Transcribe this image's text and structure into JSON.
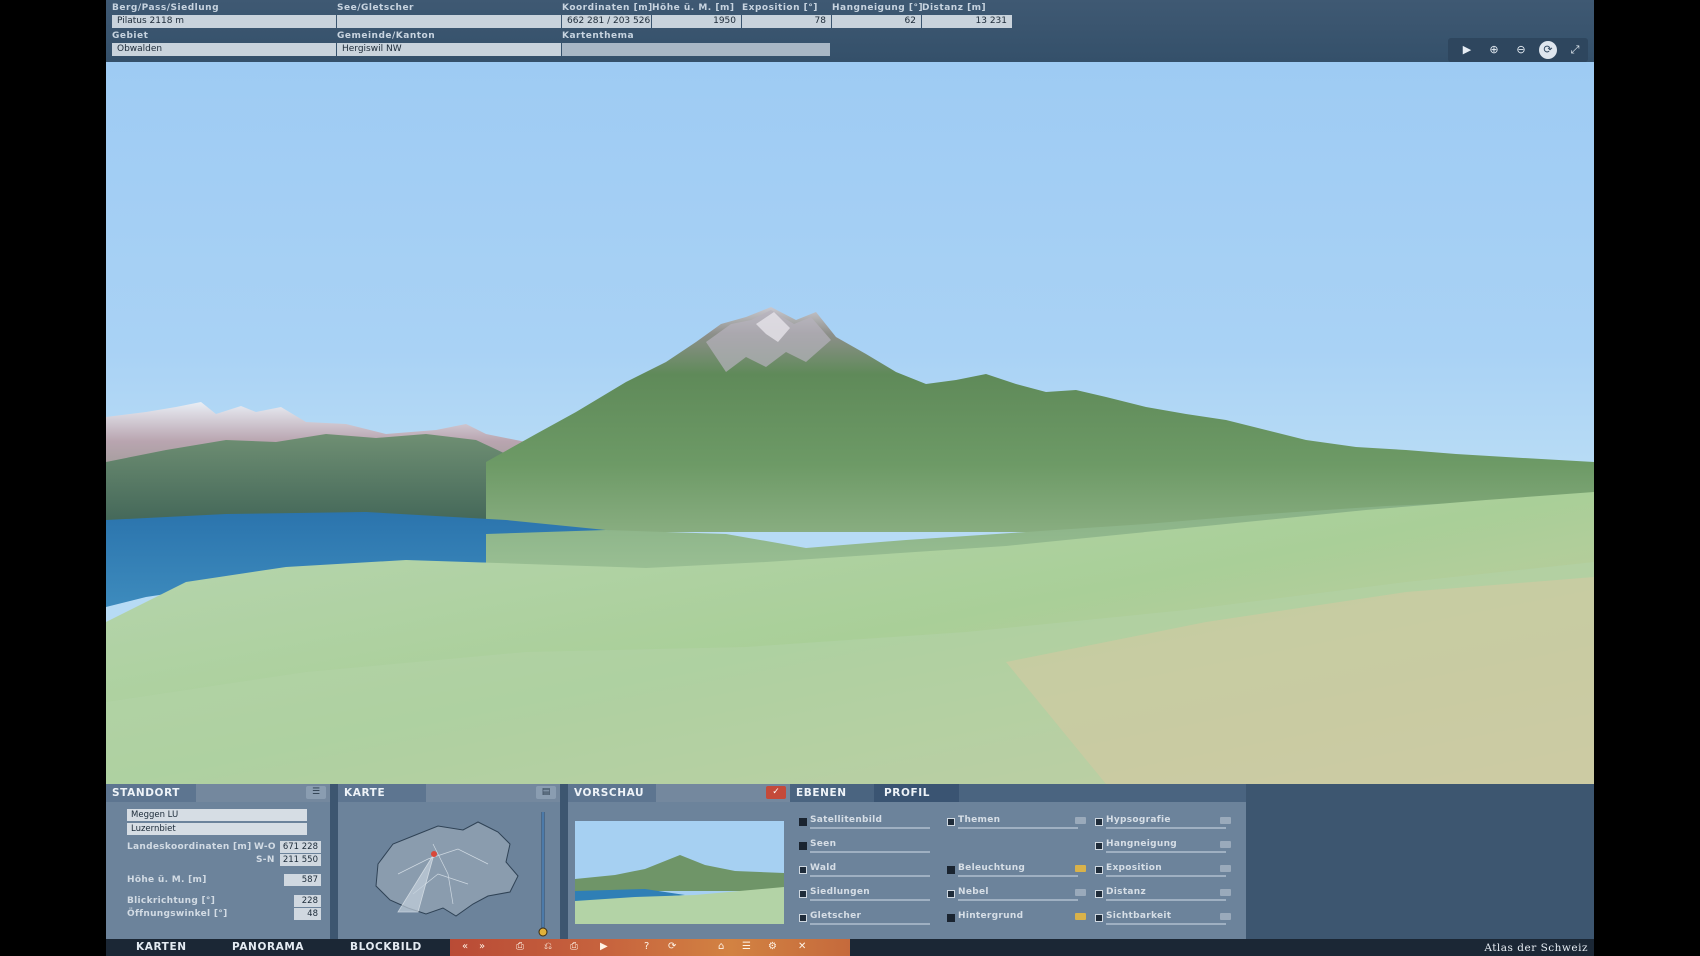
{
  "info": {
    "berg_label": "Berg/Pass/Siedlung",
    "berg_value": "Pilatus   2118 m",
    "see_label": "See/Gletscher",
    "see_value": "",
    "koord_label": "Koordinaten [m]",
    "koord_value": "662 281 / 203 526",
    "hoehe_label": "Höhe ü. M. [m]",
    "hoehe_value": "1950",
    "expo_label": "Exposition [°]",
    "expo_value": "78",
    "hang_label": "Hangneigung [°]",
    "hang_value": "62",
    "dist_label": "Distanz [m]",
    "dist_value": "13 231",
    "gebiet_label": "Gebiet",
    "gebiet_value": "Obwalden",
    "gemeinde_label": "Gemeinde/Kanton",
    "gemeinde_value": "Hergiswil  NW",
    "thema_label": "Kartenthema",
    "thema_value": ""
  },
  "toolbar": {
    "icons": [
      "pointer-icon",
      "zoom-in-icon",
      "zoom-out-icon",
      "rotate-icon",
      "fullscreen-icon"
    ]
  },
  "standort": {
    "title": "STANDORT",
    "place": "Meggen  LU",
    "region": "Luzernbiet",
    "coord_label": "Landeskoordinaten [m]",
    "wo_label": "W-O",
    "wo_value": "671 228",
    "sn_label": "S-N",
    "sn_value": "211 550",
    "hoehe_label": "Höhe ü. M. [m]",
    "hoehe_value": "587",
    "blick_label": "Blickrichtung [°]",
    "blick_value": "228",
    "oeffnung_label": "Öffnungswinkel [°]",
    "oeffnung_value": "48"
  },
  "karte": {
    "title": "KARTE"
  },
  "vorschau": {
    "title": "VORSCHAU"
  },
  "ebenen": {
    "tab1": "EBENEN",
    "tab2": "PROFIL",
    "col1": [
      "Satellitenbild",
      "Seen",
      "Wald",
      "Siedlungen",
      "Gletscher"
    ],
    "col2": [
      "Themen",
      "Beleuchtung",
      "Nebel",
      "Hintergrund"
    ],
    "col3": [
      "Hypsografie",
      "Hangneigung",
      "Exposition",
      "Distanz",
      "Sichtbarkeit"
    ]
  },
  "nav": {
    "karten": "KARTEN",
    "panorama": "PANORAMA",
    "blockbild": "BLOCKBILD",
    "brand": "Atlas der Schweiz"
  },
  "colors": {
    "panel": "#6c839b",
    "background": "#3d5670",
    "sky": "#a9d2f5",
    "lake": "#2f7fb6",
    "accent": "#c45a3b"
  }
}
